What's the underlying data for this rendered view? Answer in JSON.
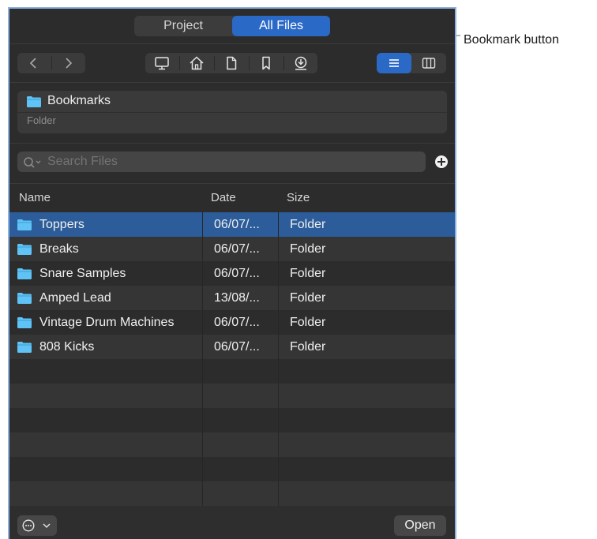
{
  "tabs": [
    {
      "label": "Project",
      "selected": false
    },
    {
      "label": "All Files",
      "selected": true
    }
  ],
  "navigation": {
    "back_icon": "chevron-left-icon",
    "forward_icon": "chevron-right-icon"
  },
  "toolbar_icons": [
    "desktop-icon",
    "home-icon",
    "document-icon",
    "bookmark-icon",
    "download-icon"
  ],
  "view_modes": [
    {
      "icon": "list-view-icon",
      "active": true
    },
    {
      "icon": "column-view-icon",
      "active": false
    }
  ],
  "location": {
    "name": "Bookmarks",
    "kind": "Folder"
  },
  "search": {
    "placeholder": "Search Files",
    "value": ""
  },
  "table": {
    "headers": [
      "Name",
      "Date",
      "Size"
    ],
    "rows": [
      {
        "name": "Toppers",
        "date": "06/07/...",
        "size": "Folder"
      },
      {
        "name": "Breaks",
        "date": "06/07/...",
        "size": "Folder"
      },
      {
        "name": "Snare Samples",
        "date": "06/07/...",
        "size": "Folder"
      },
      {
        "name": "Amped Lead",
        "date": "13/08/...",
        "size": "Folder"
      },
      {
        "name": "Vintage Drum Machines",
        "date": "06/07/...",
        "size": "Folder"
      },
      {
        "name": "808 Kicks",
        "date": "06/07/...",
        "size": "Folder"
      }
    ],
    "selected_row": 0
  },
  "footer": {
    "more_icon": "ellipsis-circle-icon",
    "open_label": "Open"
  },
  "callout": {
    "label": "Bookmark button"
  },
  "colors": {
    "accent": "#2b69c7",
    "selection": "#2c5d9a",
    "folder": "#5fc3f5",
    "panel": "#2c2c2c"
  }
}
